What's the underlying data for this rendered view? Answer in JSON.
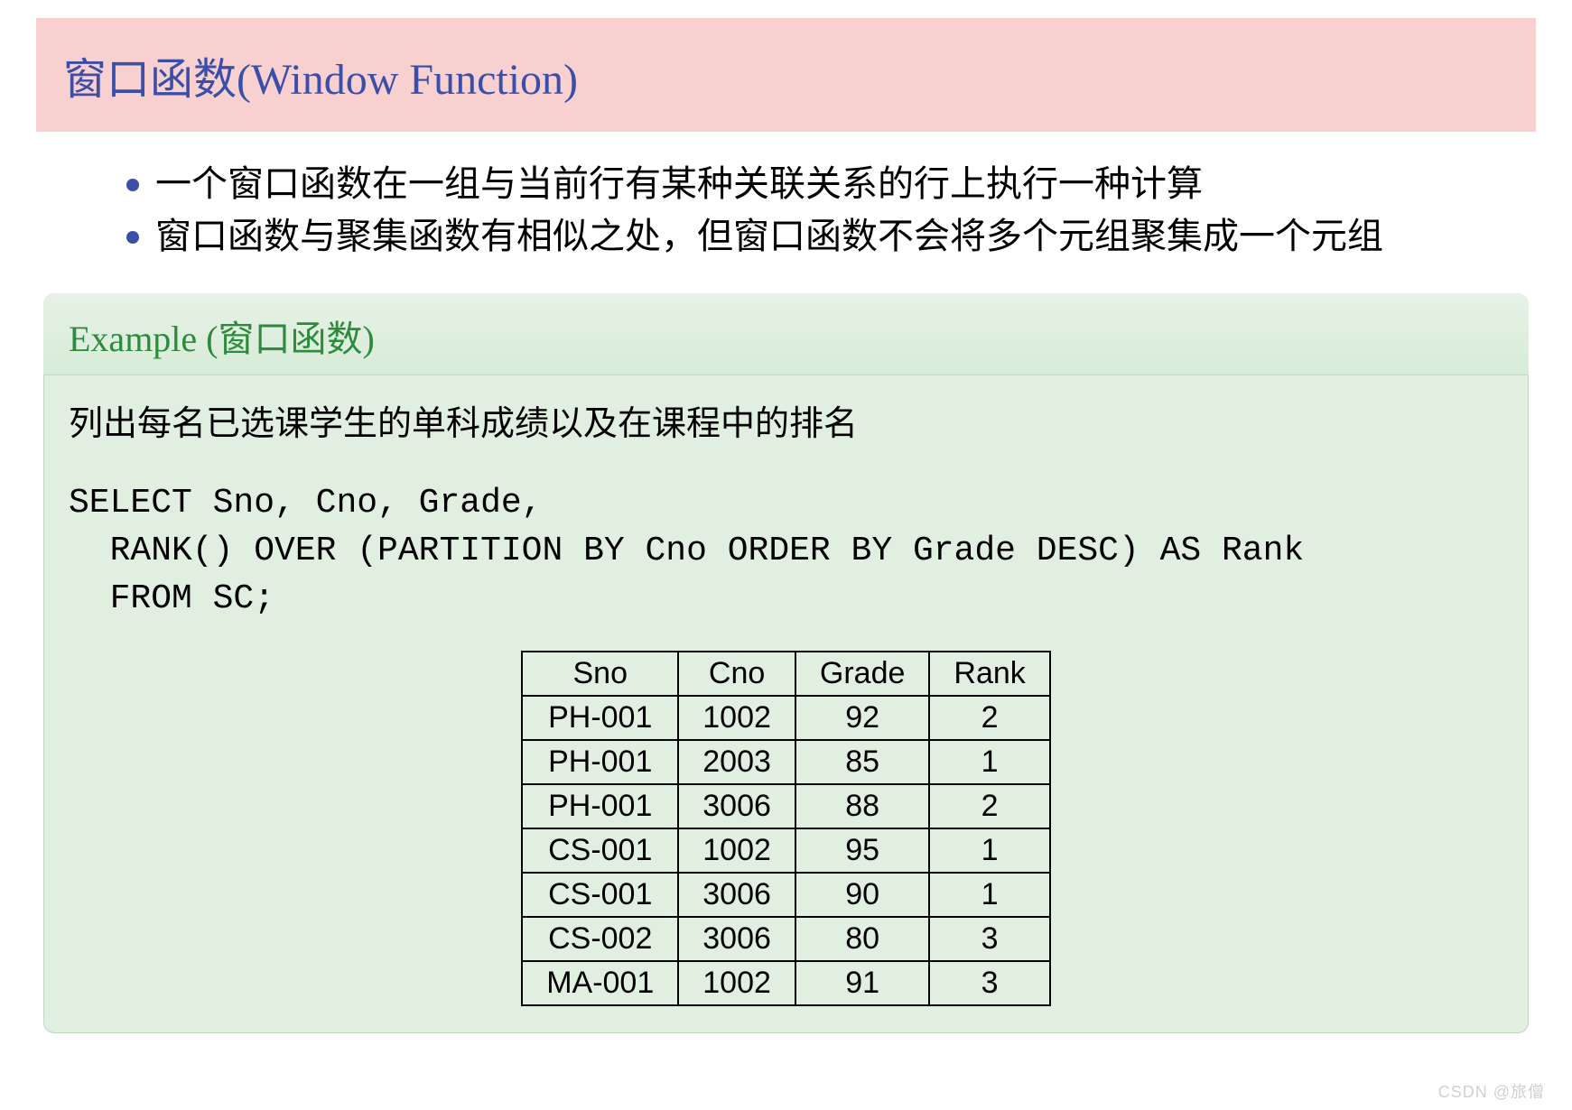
{
  "title": "窗口函数(Window Function)",
  "bullets": [
    "一个窗口函数在一组与当前行有某种关联关系的行上执行一种计算",
    "窗口函数与聚集函数有相似之处，但窗口函数不会将多个元组聚集成一个元组"
  ],
  "example": {
    "heading_prefix": "Example (",
    "heading_cn": "窗口函数",
    "heading_suffix": ")",
    "description": "列出每名已选课学生的单科成绩以及在课程中的排名",
    "sql_line1": "SELECT Sno, Cno, Grade,",
    "sql_line2": "  RANK() OVER (PARTITION BY Cno ORDER BY Grade DESC) AS Rank",
    "sql_line3": "  FROM SC;",
    "table": {
      "headers": [
        "Sno",
        "Cno",
        "Grade",
        "Rank"
      ],
      "rows": [
        [
          "PH-001",
          "1002",
          "92",
          "2"
        ],
        [
          "PH-001",
          "2003",
          "85",
          "1"
        ],
        [
          "PH-001",
          "3006",
          "88",
          "2"
        ],
        [
          "CS-001",
          "1002",
          "95",
          "1"
        ],
        [
          "CS-001",
          "3006",
          "90",
          "1"
        ],
        [
          "CS-002",
          "3006",
          "80",
          "3"
        ],
        [
          "MA-001",
          "1002",
          "91",
          "3"
        ]
      ]
    }
  },
  "watermark": "CSDN @旅僧"
}
